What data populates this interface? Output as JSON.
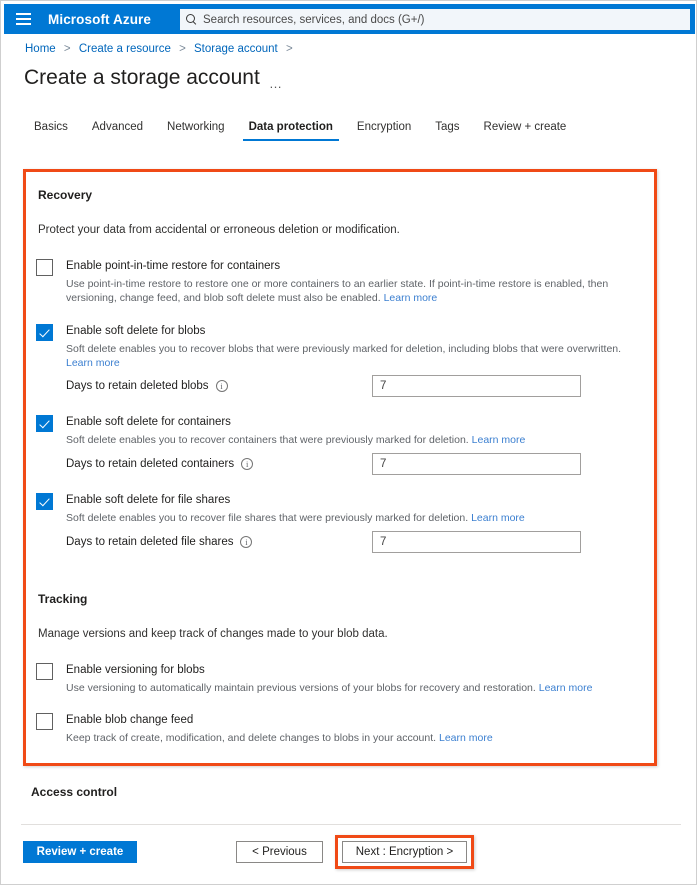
{
  "topbar": {
    "menu_icon": "hamburger-icon",
    "brand": "Microsoft Azure",
    "search_icon": "search-icon",
    "search_placeholder": "Search resources, services, and docs (G+/)",
    "search_value": "",
    "background_color": "#0078d4"
  },
  "breadcrumb": {
    "items": [
      "Home",
      "Create a resource",
      "Storage account"
    ],
    "separator": ">",
    "link_color": "#0066bb"
  },
  "header": {
    "title": "Create a storage account",
    "ellipsis": "…"
  },
  "tabs": {
    "items": [
      {
        "label": "Basics",
        "active": false
      },
      {
        "label": "Advanced",
        "active": false
      },
      {
        "label": "Networking",
        "active": false
      },
      {
        "label": "Data protection",
        "active": true
      },
      {
        "label": "Encryption",
        "active": false
      },
      {
        "label": "Tags",
        "active": false
      },
      {
        "label": "Review + create",
        "active": false
      }
    ],
    "active_underline_color": "#0078d4"
  },
  "recovery": {
    "heading": "Recovery",
    "description": "Protect your data from accidental or erroneous deletion or modification.",
    "options": [
      {
        "label": "Enable point-in-time restore for containers",
        "checked": false,
        "help": "Use point-in-time restore to restore one or more containers to an earlier state. If point-in-time restore is enabled, then versioning, change feed, and blob soft delete must also be enabled.",
        "link": "Learn more",
        "days_label": null,
        "days_value": null
      },
      {
        "label": "Enable soft delete for blobs",
        "checked": true,
        "help": "Soft delete enables you to recover blobs that were previously marked for deletion, including blobs that were overwritten.",
        "link": "Learn more",
        "days_label": "Days to retain deleted blobs",
        "days_value": "7"
      },
      {
        "label": "Enable soft delete for containers",
        "checked": true,
        "help": "Soft delete enables you to recover containers that were previously marked for deletion.",
        "link": "Learn more",
        "days_label": "Days to retain deleted containers",
        "days_value": "7"
      },
      {
        "label": "Enable soft delete for file shares",
        "checked": true,
        "help": "Soft delete enables you to recover file shares that were previously marked for deletion.",
        "link": "Learn more",
        "days_label": "Days to retain deleted file shares",
        "days_value": "7"
      }
    ]
  },
  "tracking": {
    "heading": "Tracking",
    "description": "Manage versions and keep track of changes made to your blob data.",
    "options": [
      {
        "label": "Enable versioning for blobs",
        "checked": false,
        "help": "Use versioning to automatically maintain previous versions of your blobs for recovery and restoration.",
        "link": "Learn more"
      },
      {
        "label": "Enable blob change feed",
        "checked": false,
        "help": "Keep track of create, modification, and delete changes to blobs in your account.",
        "link": "Learn more"
      }
    ]
  },
  "access_control": {
    "heading": "Access control"
  },
  "footer": {
    "review_create": "Review + create",
    "previous": "< Previous",
    "next": "Next : Encryption >"
  },
  "annotations": {
    "highlight_color": "#f04a16",
    "regions": [
      "recovery-tracking-section",
      "next-encryption-button"
    ]
  }
}
